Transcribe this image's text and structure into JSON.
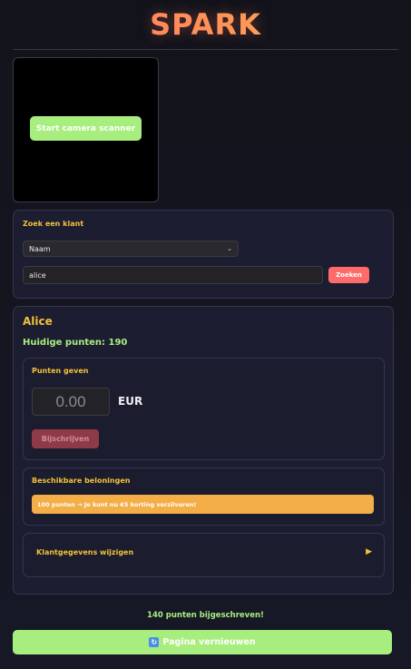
{
  "app": {
    "logo": "SPARK"
  },
  "camera": {
    "start_label": "Start camera scanner"
  },
  "search": {
    "title": "Zoek een klant",
    "field_selected": "Naam",
    "query": "alice",
    "button_label": "Zoeken"
  },
  "customer": {
    "name": "Alice",
    "points_text": "Huidige punten: 190",
    "give_points": {
      "title": "Punten geven",
      "amount": "0.00",
      "currency": "EUR",
      "button_label": "Bijschrijven"
    },
    "rewards": {
      "title": "Beschikbare beloningen",
      "items": [
        "100 punten → Je kunt nu €5 korting verzilveren!"
      ]
    },
    "edit": {
      "title": "Klantgegevens wijzigen"
    }
  },
  "status_message": "140 punten bijgeschreven!",
  "refresh": {
    "label": "Pagina vernieuwen",
    "icon": "refresh-icon"
  },
  "colors": {
    "accent_green": "#a8ee7f",
    "accent_red": "#ff6b6b",
    "accent_yellow": "#f2c23a",
    "reward_orange": "#f4ae48"
  }
}
